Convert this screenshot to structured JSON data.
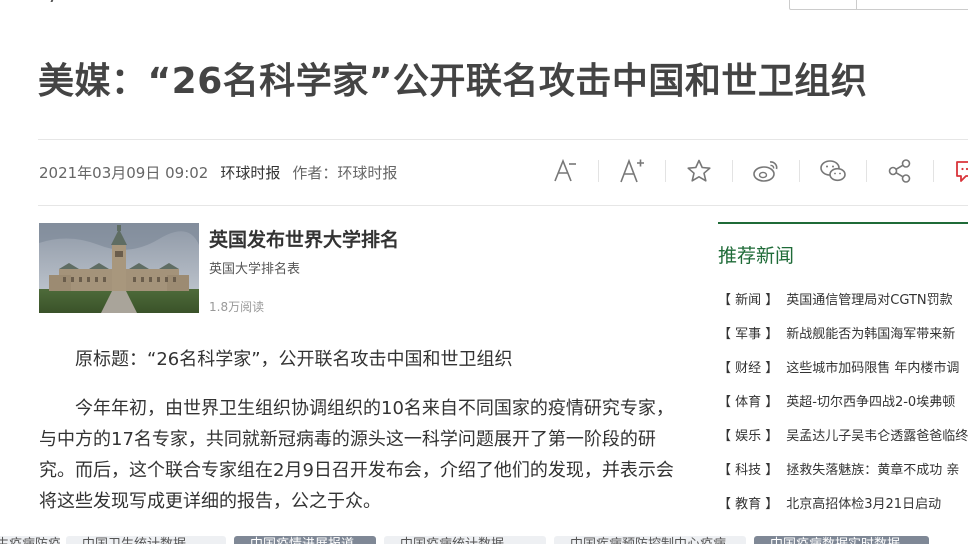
{
  "headline": "美媒：“26名科学家”公开联名攻击中国和世卫组织",
  "meta": {
    "datetime": "2021年03月09日 09:02",
    "source": "环球时报",
    "author": "作者：环球时报"
  },
  "toolbar": {
    "icons": [
      "font-decrease-icon",
      "font-increase-icon",
      "star-icon",
      "weibo-icon",
      "wechat-icon",
      "share-icon",
      "comment-icon"
    ]
  },
  "ad": {
    "title": "英国发布世界大学排名",
    "subtitle": "英国大学排名表",
    "views": "1.8万阅读"
  },
  "article": {
    "paragraphs": [
      "原标题：“26名科学家”，公开联名攻击中国和世卫组织",
      "今年年初，由世界卫生组织协调组织的10名来自不同国家的疫情研究专家，与中方的17名专家，共同就新冠病毒的源头这一科学问题展开了第一阶段的研究。而后，这个联合专家组在2月9日召开发布会，介绍了他们的发现，并表示会将这些发现写成更详细的报告，公之于众。"
    ]
  },
  "sidebar": {
    "heading": "推荐新闻",
    "items": [
      {
        "category": "【 新闻 】",
        "title": "英国通信管理局对CGTN罚款"
      },
      {
        "category": "【 军事 】",
        "title": "新战舰能否为韩国海军带来新"
      },
      {
        "category": "【 财经 】",
        "title": "这些城市加码限售 年内楼市调"
      },
      {
        "category": "【 体育 】",
        "title": "英超-切尔西争四战2-0埃弗顿"
      },
      {
        "category": "【 娱乐 】",
        "title": "吴孟达儿子吴韦仑透露爸爸临终"
      },
      {
        "category": "【 科技 】",
        "title": "拯救失落魅族：黄章不成功 亲"
      },
      {
        "category": "【 教育 】",
        "title": "北京高招体检3月21日启动"
      }
    ]
  },
  "tagbar": {
    "tags": [
      "生疫病防疫情",
      "中国卫生统计数据",
      "中国疫情进展报道",
      "中国疫病统计数据",
      "中国疾病预防控制中心疫病",
      "中国疫病数据实时数据"
    ]
  },
  "colors": {
    "accent_green": "#1f6b38",
    "comment_red": "#d9343a"
  }
}
